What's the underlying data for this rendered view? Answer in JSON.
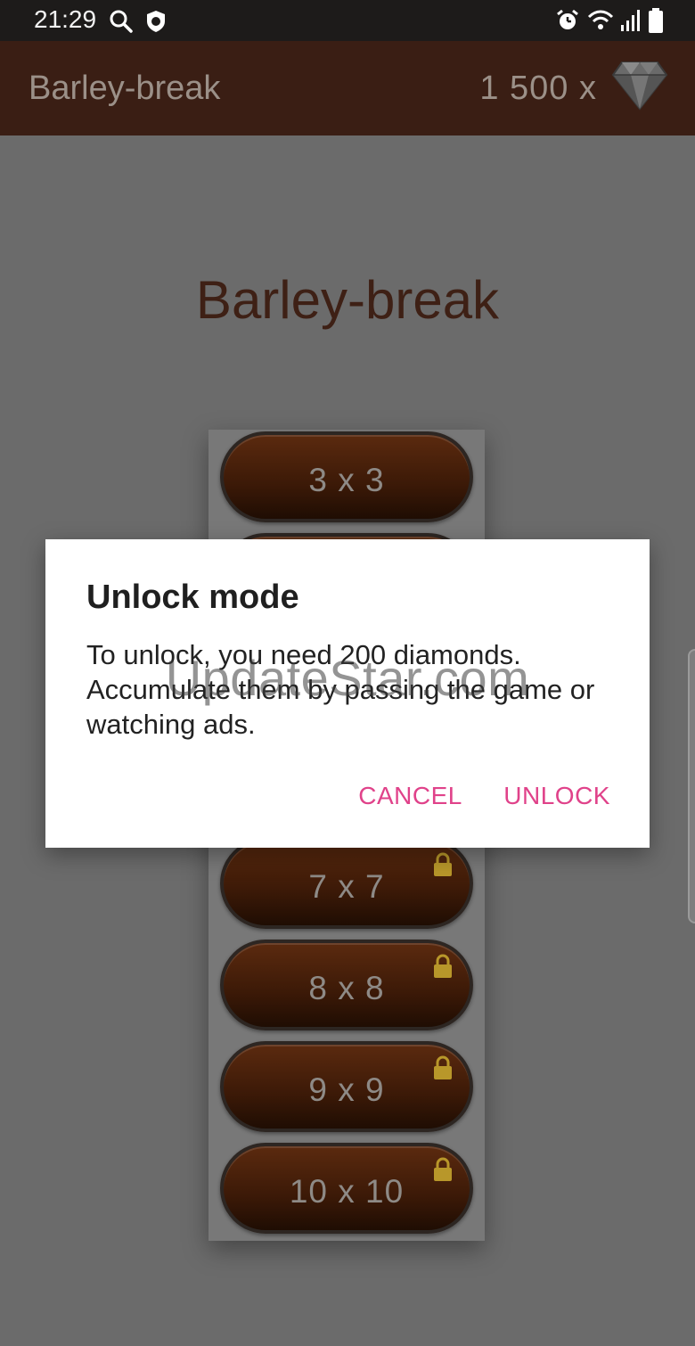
{
  "status_bar": {
    "time": "21:29",
    "left_icons": [
      "search-icon",
      "shield-icon"
    ],
    "right_icons": [
      "alarm-icon",
      "wifi-icon",
      "signal-icon",
      "battery-icon"
    ]
  },
  "app_bar": {
    "title": "Barley-break",
    "diamond_count": "1 500  x",
    "diamond_icon": "diamond-icon"
  },
  "main": {
    "title": "Barley-break",
    "modes": [
      {
        "label": "3 x 3",
        "locked": false
      },
      {
        "label": "",
        "locked": false
      },
      {
        "label": "7 x 7",
        "locked": true
      },
      {
        "label": "8 x 8",
        "locked": true
      },
      {
        "label": "9 x 9",
        "locked": true
      },
      {
        "label": "10 x 10",
        "locked": true
      }
    ]
  },
  "dialog": {
    "title": "Unlock mode",
    "body": "To unlock, you need 200 diamonds. Accumulate them by passing the game or watching ads.",
    "cancel_label": "CANCEL",
    "unlock_label": "UNLOCK"
  },
  "watermark": "UpdateStar.com",
  "colors": {
    "app_bar": "#3a1e14",
    "accent": "#e0428a",
    "button_brown": "#4a210b"
  }
}
